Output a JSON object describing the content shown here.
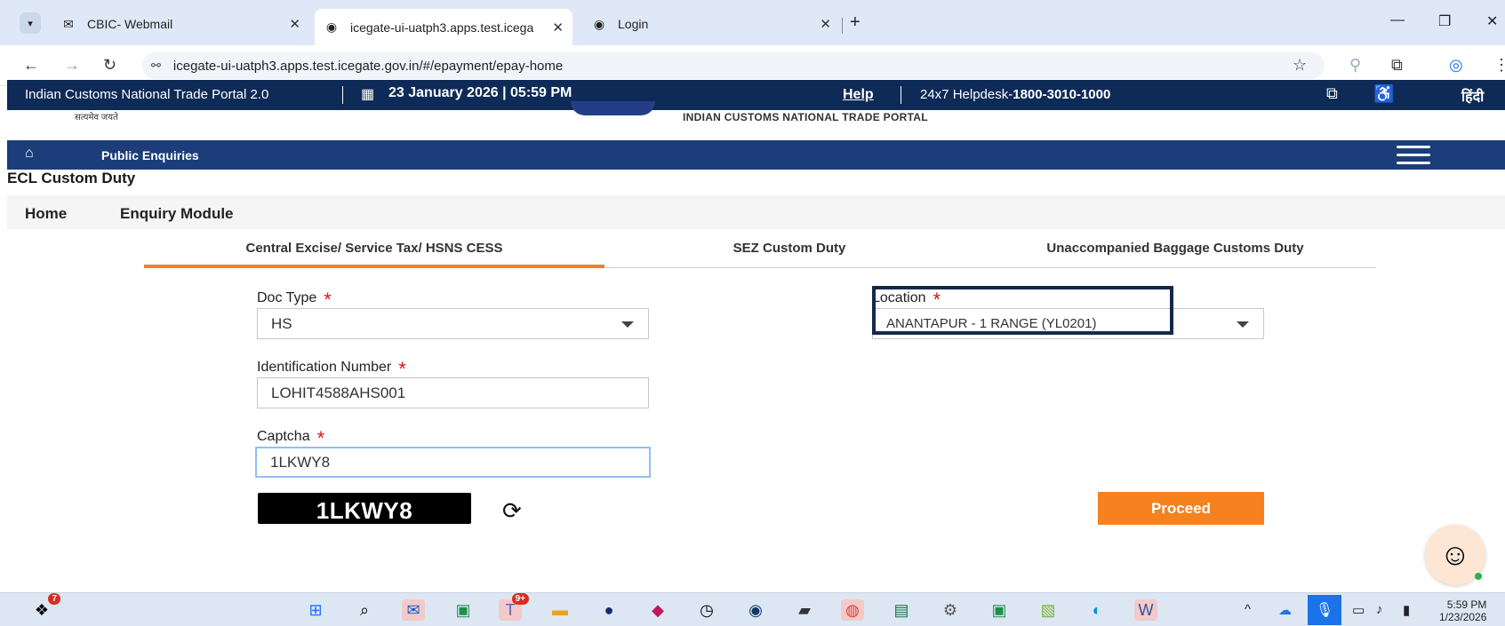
{
  "browser": {
    "tabs": [
      {
        "title": "CBIC- Webmail",
        "icon": "mail-icon"
      },
      {
        "title": "icegate-ui-uatph3.apps.test.icega",
        "icon": "site-emblem-icon"
      },
      {
        "title": "Login",
        "icon": "site-emblem-icon"
      }
    ],
    "url": "icegate-ui-uatph3.apps.test.icegate.gov.in/#/epayment/epay-home"
  },
  "portal": {
    "title": "Indian Customs National Trade Portal 2.0",
    "datetime": "23 January 2026 | 05:59 PM",
    "help": "Help",
    "helpdesk_prefix": "24x7 Helpdesk-",
    "helpdesk_number": "1800-3010-1000",
    "hindi": "हिंदी",
    "motto": "सत्यमेव जयते",
    "portal_name": "INDIAN CUSTOMS NATIONAL TRADE PORTAL"
  },
  "nav": {
    "public_enquiries": "Public Enquiries"
  },
  "page": {
    "heading": "ECL Custom Duty",
    "breadcrumb": [
      "Home",
      "Enquiry Module"
    ],
    "tabs": [
      "Central Excise/ Service Tax/ HSNS CESS",
      "SEZ Custom Duty",
      "Unaccompanied Baggage Customs Duty"
    ],
    "active_tab": 0
  },
  "form": {
    "doc_type_label": "Doc Type",
    "doc_type_value": "HS",
    "location_label": "Location",
    "location_value": "ANANTAPUR - 1 RANGE (YL0201)",
    "id_label": "Identification Number",
    "id_value": "LOHIT4588AHS001",
    "captcha_label": "Captcha",
    "captcha_value": "1LKWY8",
    "captcha_image_text": "1LKWY8",
    "required_mark": "*",
    "proceed_label": "Proceed"
  },
  "taskbar": {
    "notification_badge": "7",
    "teams_badge": "9+",
    "time": "5:59 PM",
    "date": "1/23/2026"
  },
  "colors": {
    "topbar": "#0e2a57",
    "navbar": "#1c3d7a",
    "accent": "#f5821f",
    "required": "#e01414"
  }
}
